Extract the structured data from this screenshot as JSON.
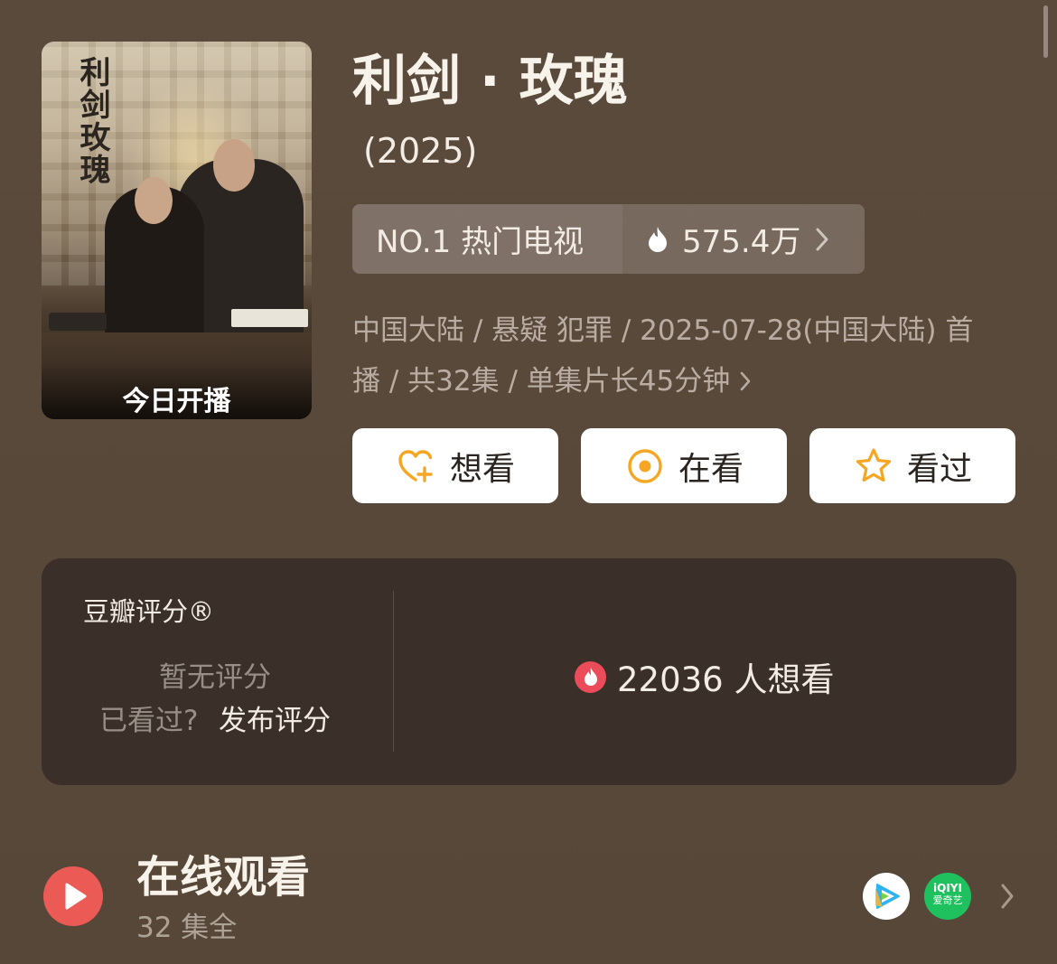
{
  "poster": {
    "vertical_title": "利剑玫瑰",
    "badge_text": "今日开播"
  },
  "show": {
    "title": "利剑 · 玫瑰",
    "year": "(2025)"
  },
  "ranking": {
    "label": "NO.1 热门电视",
    "heat_value": "575.4万"
  },
  "meta": {
    "line1": "中国大陆 / 悬疑 犯罪 / 2025-07-28(中国大陆) 首",
    "line2": "播 / 共32集 / 单集片长45分钟"
  },
  "actions": [
    {
      "label": "想看",
      "icon": "heart-plus-icon"
    },
    {
      "label": "在看",
      "icon": "target-circle-icon"
    },
    {
      "label": "看过",
      "icon": "star-icon"
    }
  ],
  "rating": {
    "label": "豆瓣评分®",
    "no_score": "暂无评分",
    "watched_prompt": "已看过?",
    "publish_label": "发布评分",
    "want_count": "22036 人想看"
  },
  "watch": {
    "title": "在线观看",
    "subtitle": "32 集全",
    "providers": [
      {
        "name": "tencent-video",
        "label": ""
      },
      {
        "name": "iqiyi",
        "label": "iQIYI",
        "sublabel": "爱奇艺"
      }
    ]
  },
  "colors": {
    "background": "#59493b",
    "card": "#3a3029",
    "accent_red": "#ec5a55",
    "accent_orange": "#f5a623",
    "button_bg": "#ffffff"
  }
}
